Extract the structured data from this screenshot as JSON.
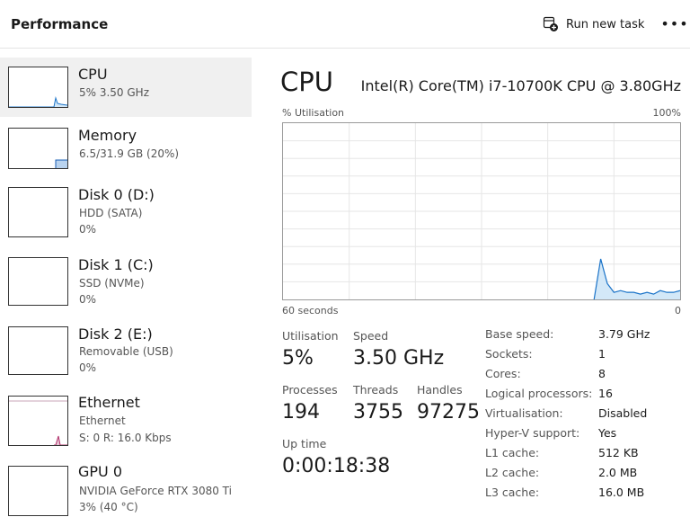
{
  "header": {
    "title": "Performance",
    "run_task_label": "Run new task",
    "more_label": "•••"
  },
  "sidebar": {
    "items": [
      {
        "title": "CPU",
        "lines": [
          "5%  3.50 GHz"
        ],
        "selected": true,
        "color": "#1a73c8"
      },
      {
        "title": "Memory",
        "lines": [
          "6.5/31.9 GB (20%)"
        ],
        "selected": false,
        "color": "#1a5fb4"
      },
      {
        "title": "Disk 0 (D:)",
        "lines": [
          "HDD (SATA)",
          "0%"
        ],
        "selected": false,
        "color": "#3f8f3f"
      },
      {
        "title": "Disk 1 (C:)",
        "lines": [
          "SSD (NVMe)",
          "0%"
        ],
        "selected": false,
        "color": "#3f8f3f"
      },
      {
        "title": "Disk 2 (E:)",
        "lines": [
          "Removable (USB)",
          "0%"
        ],
        "selected": false,
        "color": "#3f8f3f"
      },
      {
        "title": "Ethernet",
        "lines": [
          "Ethernet",
          "S: 0  R: 16.0 Kbps"
        ],
        "selected": false,
        "color": "#b0306a"
      },
      {
        "title": "GPU 0",
        "lines": [
          "NVIDIA GeForce RTX 3080 Ti",
          "3% (40 °C)"
        ],
        "selected": false,
        "color": "#3f8f3f"
      }
    ]
  },
  "main": {
    "title": "CPU",
    "cpu_name": "Intel(R) Core(TM) i7-10700K CPU @ 3.80GHz",
    "graph": {
      "y_label": "% Utilisation",
      "y_max_label": "100%",
      "x_left_label": "60 seconds",
      "x_right_label": "0",
      "line_color": "#1a73c8",
      "fill_color": "#d3e8f8"
    },
    "stats": {
      "utilisation_label": "Utilisation",
      "utilisation_value": "5%",
      "speed_label": "Speed",
      "speed_value": "3.50 GHz",
      "processes_label": "Processes",
      "processes_value": "194",
      "threads_label": "Threads",
      "threads_value": "3755",
      "handles_label": "Handles",
      "handles_value": "97275",
      "uptime_label": "Up time",
      "uptime_value": "0:00:18:38"
    },
    "properties": [
      {
        "key": "Base speed:",
        "value": "3.79 GHz"
      },
      {
        "key": "Sockets:",
        "value": "1"
      },
      {
        "key": "Cores:",
        "value": "8"
      },
      {
        "key": "Logical processors:",
        "value": "16"
      },
      {
        "key": "Virtualisation:",
        "value": "Disabled"
      },
      {
        "key": "Hyper-V support:",
        "value": "Yes"
      },
      {
        "key": "L1 cache:",
        "value": "512 KB"
      },
      {
        "key": "L2 cache:",
        "value": "2.0 MB"
      },
      {
        "key": "L3 cache:",
        "value": "16.0 MB"
      }
    ]
  },
  "chart_data": {
    "type": "area",
    "x": [
      60,
      55,
      50,
      45,
      40,
      35,
      30,
      25,
      20,
      19,
      18,
      17,
      16,
      15,
      14,
      13,
      12,
      11,
      10,
      9,
      8,
      7,
      6,
      5,
      4,
      3,
      2,
      1,
      0
    ],
    "series": [
      {
        "values": [
          0,
          0,
          0,
          0,
          0,
          0,
          0,
          0,
          0,
          0,
          0,
          0,
          0,
          0,
          0,
          0,
          23,
          9,
          4,
          5,
          4,
          4,
          3,
          4,
          3,
          5,
          4,
          4,
          5
        ]
      }
    ],
    "xlabel": "60 seconds",
    "ylabel": "% Utilisation",
    "xlim": [
      60,
      0
    ],
    "ylim": [
      0,
      100
    ],
    "grid": true
  }
}
